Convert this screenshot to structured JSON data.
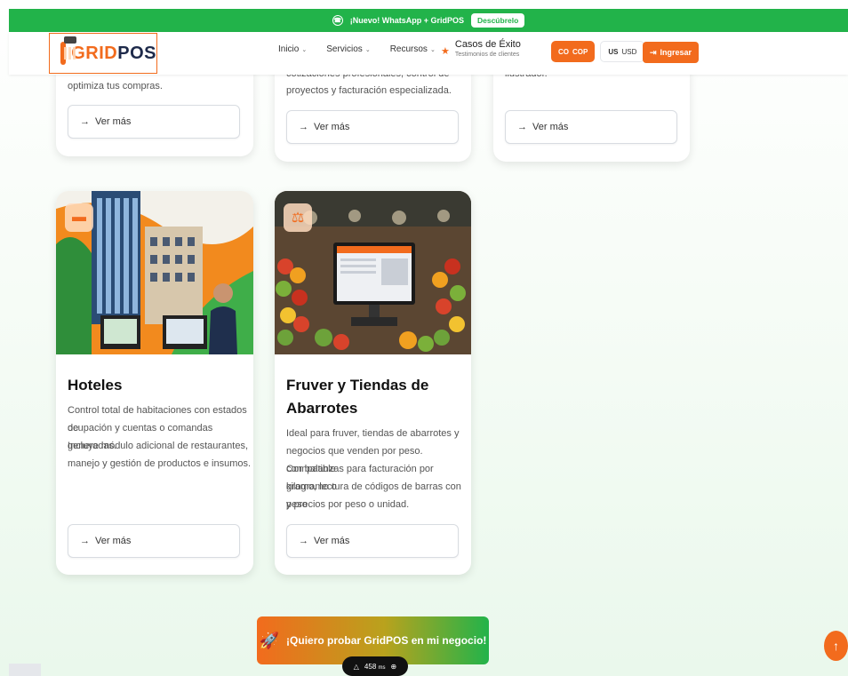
{
  "promo": {
    "text": "¡Nuevo! WhatsApp + GridPOS",
    "button": "Descúbrelo"
  },
  "header": {
    "logo_grid": "GRID",
    "logo_pos": "POS",
    "nav": [
      "Inicio",
      "Servicios",
      "Recursos"
    ],
    "exito_title": "Casos de Éxito",
    "exito_sub": "Testimonios de clientes",
    "currency_cop_icon": "CO",
    "currency_cop": "COP",
    "currency_usd_icon": "US",
    "currency_usd": "USD",
    "login": "Ingresar"
  },
  "top_cards": [
    {
      "text": "optimiza tus compras.",
      "button": "Ver más"
    },
    {
      "text1": "cotizaciones profesionales, control de",
      "text2": "proyectos y facturación especializada.",
      "button": "Ver más"
    },
    {
      "text": "ilustrador.",
      "button": "Ver más"
    }
  ],
  "cards": [
    {
      "title": "Hoteles",
      "lines": [
        "Control total de habitaciones con estados de",
        "ocupación y cuentas o comandas generadas.",
        "Incluye módulo adicional de restaurantes,",
        "manejo y gestión de productos e insumos."
      ],
      "button": "Ver más"
    },
    {
      "title1": "Fruver y Tiendas de",
      "title2": "Abarrotes",
      "lines": [
        "Ideal para fruver, tiendas de abarrotes y",
        "negocios que venden por peso. Compatible",
        "con balanzas para facturación por kilogramo o",
        "gramo, lectura de códigos de barras con peso",
        "y precios por peso o unidad."
      ],
      "button": "Ver más"
    }
  ],
  "cta": {
    "label": "¡Quiero probar GridPOS en mi negocio!"
  },
  "perf": {
    "value": "458",
    "unit": "ms"
  },
  "colors": {
    "brand_orange": "#f26b1d",
    "brand_green": "#22b34a"
  }
}
